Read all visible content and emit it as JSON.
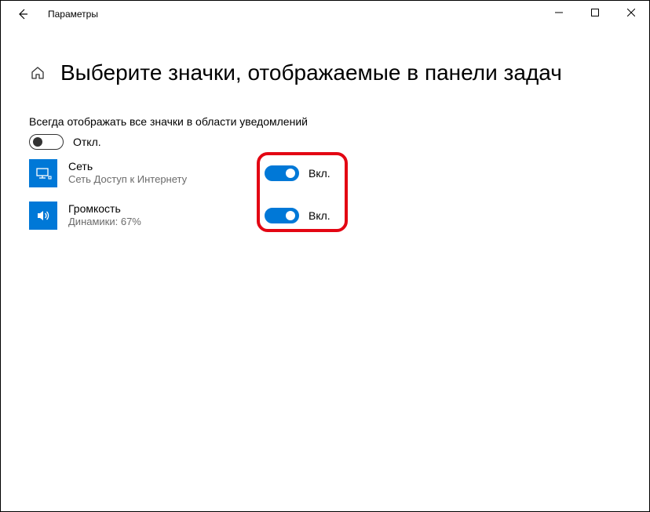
{
  "titlebar": {
    "app_name": "Параметры"
  },
  "page": {
    "title": "Выберите значки, отображаемые в панели задач"
  },
  "always_show": {
    "label": "Всегда отображать все значки в области уведомлений",
    "state_text": "Откл."
  },
  "items": [
    {
      "title": "Сеть",
      "subtitle": "Сеть Доступ к Интернету",
      "state_text": "Вкл."
    },
    {
      "title": "Громкость",
      "subtitle": "Динамики: 67%",
      "state_text": "Вкл."
    }
  ]
}
